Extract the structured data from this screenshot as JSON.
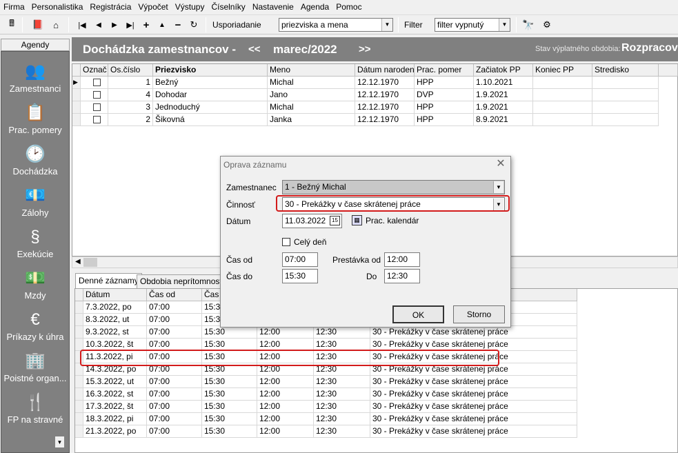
{
  "menu": [
    "Firma",
    "Personalistika",
    "Registrácia",
    "Výpočet",
    "Výstupy",
    "Číselníky",
    "Nastavenie",
    "Agenda",
    "Pomoc"
  ],
  "toolbar": {
    "sort_label": "Usporiadanie",
    "sort_value": "priezviska a mena",
    "filter_label": "Filter",
    "filter_value": "filter vypnutý",
    "icons": [
      "calculator-icon",
      "book-icon",
      "home-icon",
      "first-record-icon",
      "prev-record-icon",
      "next-record-icon",
      "last-record-icon",
      "add-record-icon",
      "up-icon",
      "delete-record-icon",
      "refresh-icon",
      "binoculars-icon",
      "settings-icon"
    ]
  },
  "sidebar": {
    "header": "Agendy",
    "items": [
      {
        "label": "Zamestnanci",
        "icon": "employees-icon"
      },
      {
        "label": "Prac. pomery",
        "icon": "employment-icon"
      },
      {
        "label": "Dochádzka",
        "icon": "attendance-icon"
      },
      {
        "label": "Zálohy",
        "icon": "advances-icon"
      },
      {
        "label": "Exekúcie",
        "icon": "paragraph-icon"
      },
      {
        "label": "Mzdy",
        "icon": "wages-icon"
      },
      {
        "label": "Príkazy k úhra",
        "icon": "sepa-icon"
      },
      {
        "label": "Poistné organ...",
        "icon": "building-icon"
      },
      {
        "label": "FP na stravné",
        "icon": "cutlery-icon"
      }
    ]
  },
  "title": {
    "main": "Dochádzka zamestnancov -",
    "prev": "<<",
    "month": "marec/2022",
    "next": ">>",
    "status_label": "Stav výplatného obdobia:",
    "status_value": "Rozpracov"
  },
  "employees": {
    "columns": [
      "Označ",
      "Os.číslo",
      "Priezvisko",
      "Meno",
      "Dátum narodenia",
      "Prac. pomer",
      "Začiatok PP",
      "Koniec PP",
      "Stredisko"
    ],
    "rows": [
      {
        "id": "1",
        "surname": "Bežný",
        "name": "Michal",
        "born": "12.12.1970",
        "type": "HPP",
        "start": "1.10.2021",
        "end": "",
        "center": ""
      },
      {
        "id": "4",
        "surname": "Dohodar",
        "name": "Jano",
        "born": "12.12.1970",
        "type": "DVP",
        "start": "1.9.2021",
        "end": "",
        "center": ""
      },
      {
        "id": "3",
        "surname": "Jednoduchý",
        "name": "Michal",
        "born": "12.12.1970",
        "type": "HPP",
        "start": "1.9.2021",
        "end": "",
        "center": ""
      },
      {
        "id": "2",
        "surname": "Šikovná",
        "name": "Janka",
        "born": "12.12.1970",
        "type": "HPP",
        "start": "8.9.2021",
        "end": "",
        "center": ""
      }
    ]
  },
  "tabs": [
    "Denné záznamy",
    "Obdobia neprítomnosti"
  ],
  "daily": {
    "columns": [
      "Dátum",
      "Čas od",
      "Čas do"
    ],
    "rows": [
      {
        "date": "7.3.2022, po",
        "from": "07:00",
        "to": "15:30",
        "b1": "",
        "b2": "",
        "act": ""
      },
      {
        "date": "8.3.2022, ut",
        "from": "07:00",
        "to": "15:30",
        "b1": "",
        "b2": "",
        "act": ""
      },
      {
        "date": "9.3.2022, st",
        "from": "07:00",
        "to": "15:30",
        "b1": "12:00",
        "b2": "12:30",
        "act": "30 - Prekážky v čase skrátenej práce"
      },
      {
        "date": "10.3.2022, št",
        "from": "07:00",
        "to": "15:30",
        "b1": "12:00",
        "b2": "12:30",
        "act": "30 - Prekážky v čase skrátenej práce"
      },
      {
        "date": "11.3.2022, pi",
        "from": "07:00",
        "to": "15:30",
        "b1": "12:00",
        "b2": "12:30",
        "act": "30 - Prekážky v čase skrátenej práce"
      },
      {
        "date": "14.3.2022, po",
        "from": "07:00",
        "to": "15:30",
        "b1": "12:00",
        "b2": "12:30",
        "act": "30 - Prekážky v čase skrátenej práce"
      },
      {
        "date": "15.3.2022, ut",
        "from": "07:00",
        "to": "15:30",
        "b1": "12:00",
        "b2": "12:30",
        "act": "30 - Prekážky v čase skrátenej práce"
      },
      {
        "date": "16.3.2022, st",
        "from": "07:00",
        "to": "15:30",
        "b1": "12:00",
        "b2": "12:30",
        "act": "30 - Prekážky v čase skrátenej práce"
      },
      {
        "date": "17.3.2022, št",
        "from": "07:00",
        "to": "15:30",
        "b1": "12:00",
        "b2": "12:30",
        "act": "30 - Prekážky v čase skrátenej práce"
      },
      {
        "date": "18.3.2022, pi",
        "from": "07:00",
        "to": "15:30",
        "b1": "12:00",
        "b2": "12:30",
        "act": "30 - Prekážky v čase skrátenej práce"
      },
      {
        "date": "21.3.2022, po",
        "from": "07:00",
        "to": "15:30",
        "b1": "12:00",
        "b2": "12:30",
        "act": "30 - Prekážky v čase skrátenej práce"
      }
    ]
  },
  "dialog": {
    "title": "Oprava záznamu",
    "employee_label": "Zamestnanec",
    "employee_value": "1 - Bežný Michal",
    "activity_label": "Činnosť",
    "activity_value": "30 - Prekážky v čase skrátenej práce",
    "date_label": "Dátum",
    "date_value": "11.03.2022",
    "calendar_icon_text": "15",
    "calendar_link": "Prac. kalendár",
    "fullday_label": "Celý deň",
    "from_label": "Čas od",
    "from_value": "07:00",
    "to_label": "Čas do",
    "to_value": "15:30",
    "break_from_label": "Prestávka od",
    "break_from_value": "12:00",
    "break_to_label": "Do",
    "break_to_value": "12:30",
    "ok": "OK",
    "cancel": "Storno"
  },
  "colors": {
    "accent_highlight": "#d21a1a",
    "panel_gray": "#808080"
  }
}
